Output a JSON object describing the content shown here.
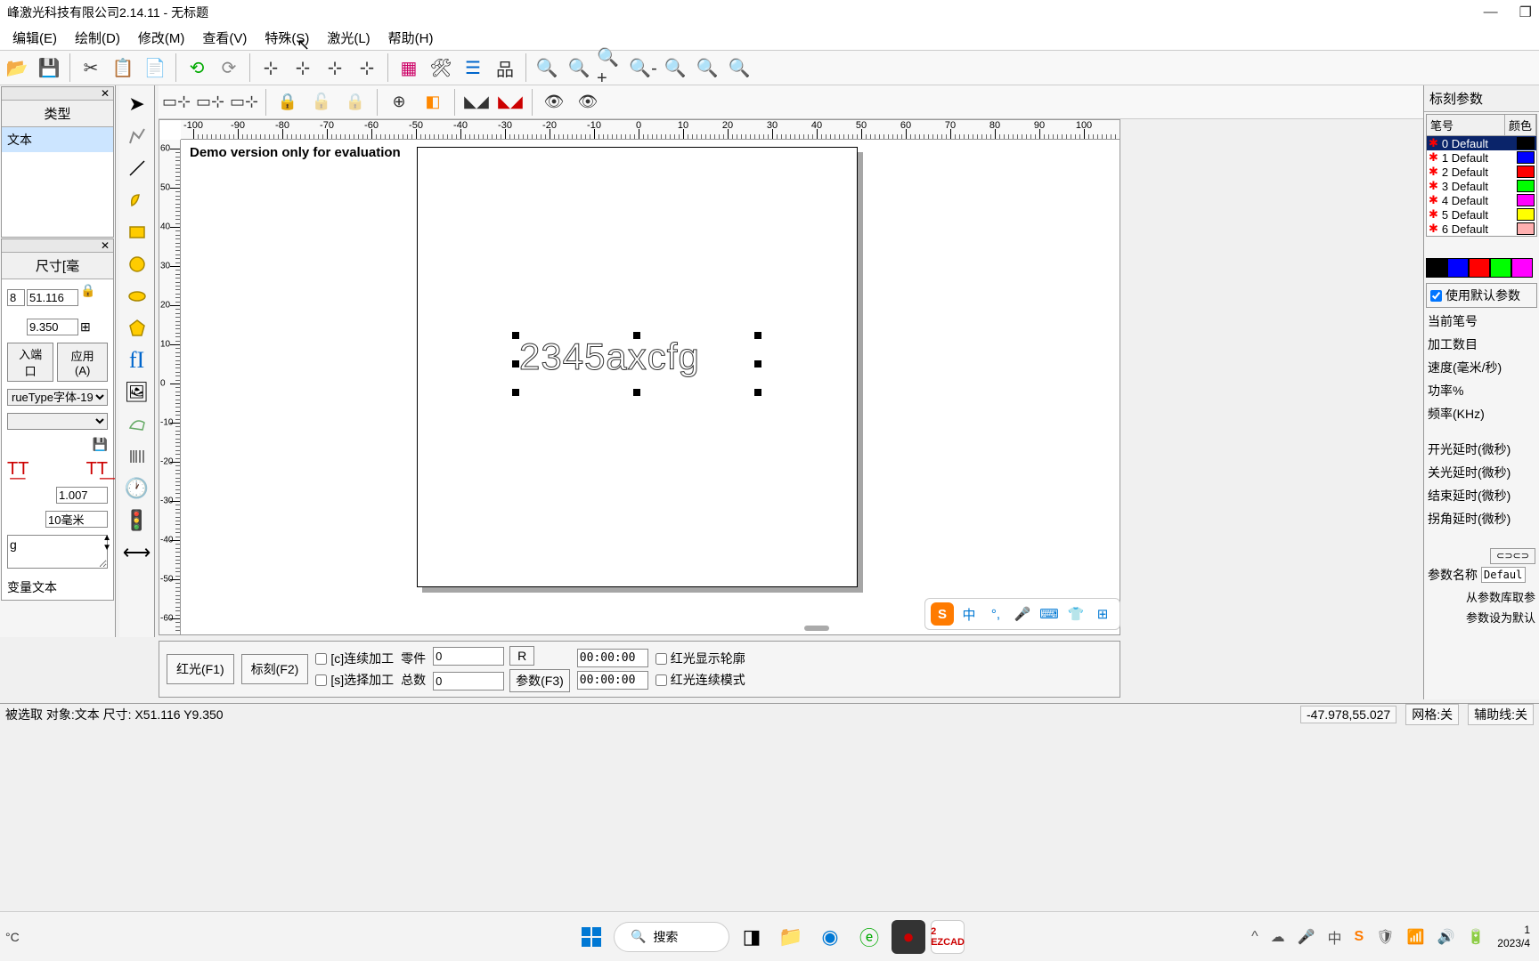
{
  "window": {
    "title": "峰激光科技有限公司2.14.11 - 无标题"
  },
  "menu": {
    "edit": "编辑(E)",
    "draw": "绘制(D)",
    "modify": "修改(M)",
    "view": "查看(V)",
    "special": "特殊(S)",
    "laser": "激光(L)",
    "help": "帮助(H)"
  },
  "left_panel": {
    "type_header": "类型",
    "type_value": "文本",
    "size_header": "尺寸[毫",
    "size_x": "8",
    "size_w": "51.116",
    "size_h": "9.350",
    "port_btn": "入端口",
    "apply_btn": "应用(A)",
    "font_dropdown": "rueType字体-19",
    "spacing": "1.007",
    "unit": "10毫米",
    "text_content": "g",
    "var_text": "变量文本"
  },
  "canvas": {
    "demo_text": "Demo version only for evaluation",
    "placed_text": "2345axcfg"
  },
  "right_panel": {
    "title": "标刻参数",
    "pen_col": "笔号",
    "color_col": "颜色",
    "pens": [
      {
        "n": "0 Default",
        "c": "#000000"
      },
      {
        "n": "1 Default",
        "c": "#0000ff"
      },
      {
        "n": "2 Default",
        "c": "#ff0000"
      },
      {
        "n": "3 Default",
        "c": "#00ff00"
      },
      {
        "n": "4 Default",
        "c": "#ff00ff"
      },
      {
        "n": "5 Default",
        "c": "#ffff00"
      },
      {
        "n": "6 Default",
        "c": "#ffb0b0"
      }
    ],
    "strip_colors": [
      "#000000",
      "#0000ff",
      "#ff0000",
      "#00ff00",
      "#ff00ff"
    ],
    "use_default": "使用默认参数",
    "current_pen": "当前笔号",
    "process_count": "加工数目",
    "speed": "速度(毫米/秒)",
    "power": "功率%",
    "freq": "频率(KHz)",
    "on_delay": "开光延时(微秒)",
    "off_delay": "关光延时(微秒)",
    "end_delay": "结束延时(微秒)",
    "corner_delay": "拐角延时(微秒)",
    "param_name": "参数名称",
    "param_value": "Defaul",
    "from_lib": "从参数库取参",
    "as_default": "参数设为默认"
  },
  "bottom": {
    "red_f1": "红光(F1)",
    "mark_f2": "标刻(F2)",
    "continuous_c": "[c]连续加工",
    "select_s": "[s]选择加工",
    "parts": "零件",
    "total": "总数",
    "parts_val": "0",
    "total_val": "0",
    "r_btn": "R",
    "param_f3": "参数(F3)",
    "time1": "00:00:00",
    "time2": "00:00:00",
    "red_contour": "红光显示轮廓",
    "red_cont_mode": "红光连续模式"
  },
  "status": {
    "selection": "被选取 对象:文本 尺寸: X51.116 Y9.350",
    "coords": "-47.978,55.027",
    "grid": "网格:关",
    "guides": "辅助线:关"
  },
  "taskbar": {
    "weather": "°C",
    "search": "搜索",
    "ime_lang": "中",
    "time": "1",
    "date": "2023/4"
  },
  "ruler_h": [
    "-100",
    "-90",
    "-80",
    "-70",
    "-60",
    "-50",
    "-40",
    "-30",
    "-20",
    "-10",
    "0",
    "10",
    "20",
    "30",
    "40",
    "50",
    "60",
    "70",
    "80",
    "90",
    "100"
  ],
  "ruler_v": [
    "60",
    "50",
    "40",
    "30",
    "20",
    "10",
    "0",
    "-10",
    "-20",
    "-30",
    "-40",
    "-50",
    "-60"
  ]
}
